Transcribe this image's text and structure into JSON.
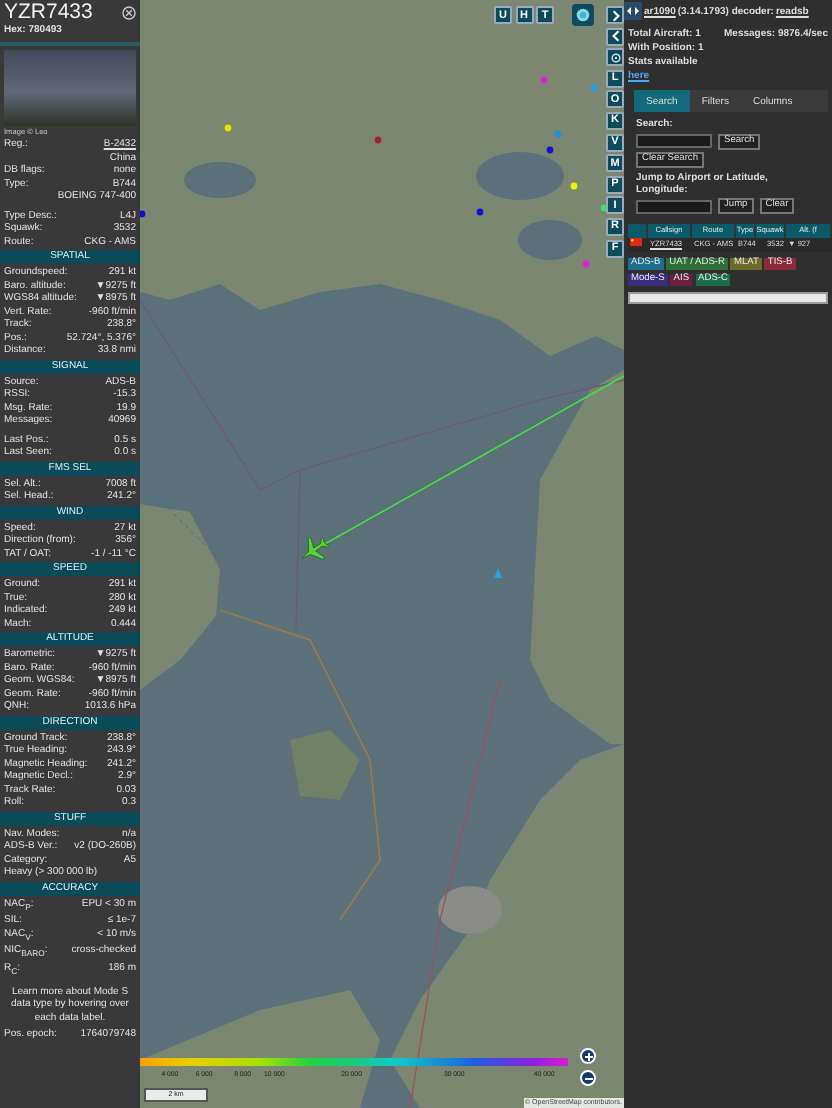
{
  "aircraft": {
    "callsign": "YZR7433",
    "hex": "Hex: 780493",
    "photo_credit": "Image © Leo",
    "sections": [
      {
        "rows": [
          {
            "kind": "link",
            "label": "Reg.:",
            "value": "B-2432"
          },
          {
            "kind": "value",
            "value": "China"
          },
          {
            "kind": "pair",
            "label": "DB flags:",
            "value": "none"
          },
          {
            "kind": "pair",
            "label": "Type:",
            "value": "B744"
          },
          {
            "kind": "value",
            "value": "BOEING 747-400"
          },
          {
            "kind": "pair",
            "label": "Type Desc.:",
            "value": "L4J",
            "gap": true
          },
          {
            "kind": "pair",
            "label": "Squawk:",
            "value": "3532"
          },
          {
            "kind": "pair",
            "label": "Route:",
            "value": "CKG - AMS"
          }
        ]
      },
      {
        "title": "SPATIAL",
        "rows": [
          {
            "kind": "pair",
            "label": "Groundspeed:",
            "value": "291 kt"
          },
          {
            "kind": "pair",
            "label": "Baro. altitude:",
            "value": "▼9275 ft"
          },
          {
            "kind": "pair",
            "label": "WGS84 altitude:",
            "value": "▼8975 ft"
          },
          {
            "kind": "pair",
            "label": "Vert. Rate:",
            "value": "-960 ft/min"
          },
          {
            "kind": "pair",
            "label": "Track:",
            "value": "238.8°"
          },
          {
            "kind": "pair",
            "label": "Pos.:",
            "value": "52.724°, 5.376°"
          },
          {
            "kind": "pair",
            "label": "Distance:",
            "value": "33.8 nmi"
          }
        ]
      },
      {
        "title": "SIGNAL",
        "rows": [
          {
            "kind": "pair",
            "label": "Source:",
            "value": "ADS-B"
          },
          {
            "kind": "pair",
            "label": "RSSI:",
            "value": "-15.3"
          },
          {
            "kind": "pair",
            "label": "Msg. Rate:",
            "value": "19.9"
          },
          {
            "kind": "pair",
            "label": "Messages:",
            "value": "40969"
          },
          {
            "kind": "pair",
            "label": "Last Pos.:",
            "value": "0.5 s",
            "gap": true
          },
          {
            "kind": "pair",
            "label": "Last Seen:",
            "value": "0.0 s"
          }
        ]
      },
      {
        "title": "FMS SEL",
        "rows": [
          {
            "kind": "pair",
            "label": "Sel. Alt.:",
            "value": "7008 ft"
          },
          {
            "kind": "pair",
            "label": "Sel. Head.:",
            "value": "241.2°"
          }
        ]
      },
      {
        "title": "WIND",
        "rows": [
          {
            "kind": "pair",
            "label": "Speed:",
            "value": "27 kt"
          },
          {
            "kind": "pair",
            "label": "Direction (from):",
            "value": "356°"
          },
          {
            "kind": "pair",
            "label": "TAT / OAT:",
            "value": "-1 / -11 °C"
          }
        ]
      },
      {
        "title": "SPEED",
        "rows": [
          {
            "kind": "pair",
            "label": "Ground:",
            "value": "291 kt"
          },
          {
            "kind": "pair",
            "label": "True:",
            "value": "280 kt"
          },
          {
            "kind": "pair",
            "label": "Indicated:",
            "value": "249 kt"
          },
          {
            "kind": "pair",
            "label": "Mach:",
            "value": "0.444"
          }
        ]
      },
      {
        "title": "ALTITUDE",
        "rows": [
          {
            "kind": "pair",
            "label": "Barometric:",
            "value": "▼9275 ft"
          },
          {
            "kind": "pair",
            "label": "Baro. Rate:",
            "value": "-960 ft/min"
          },
          {
            "kind": "pair",
            "label": "Geom. WGS84:",
            "value": "▼8975 ft"
          },
          {
            "kind": "pair",
            "label": "Geom. Rate:",
            "value": "-960 ft/min"
          },
          {
            "kind": "pair",
            "label": "QNH:",
            "value": "1013.6 hPa"
          }
        ]
      },
      {
        "title": "DIRECTION",
        "rows": [
          {
            "kind": "pair",
            "label": "Ground Track:",
            "value": "238.8°"
          },
          {
            "kind": "pair",
            "label": "True Heading:",
            "value": "243.9°"
          },
          {
            "kind": "pair",
            "label": "Magnetic Heading:",
            "value": "241.2°"
          },
          {
            "kind": "pair",
            "label": "Magnetic Decl.:",
            "value": "2.9°"
          },
          {
            "kind": "pair",
            "label": "Track Rate:",
            "value": "0.03"
          },
          {
            "kind": "pair",
            "label": "Roll:",
            "value": "0.3"
          }
        ]
      },
      {
        "title": "STUFF",
        "rows": [
          {
            "kind": "pair",
            "label": "Nav. Modes:",
            "value": "n/a"
          },
          {
            "kind": "pair",
            "label": "ADS-B Ver.:",
            "value": "v2 (DO-260B)"
          },
          {
            "kind": "pair",
            "label": "Category:",
            "value": "A5"
          },
          {
            "kind": "text",
            "value": "Heavy (> 300 000 lb)"
          }
        ]
      },
      {
        "title": "ACCURACY",
        "rows": [
          {
            "kind": "pair",
            "label": "NAC$_{P}$:",
            "value": "EPU < 30 m"
          },
          {
            "kind": "pair",
            "label": "SIL:",
            "value": "≤ 1e-7"
          },
          {
            "kind": "pair",
            "label": "NAC$_{V}$:",
            "value": "< 10 m/s"
          },
          {
            "kind": "pair",
            "label": "NIC$_{BARO}$:",
            "value": "cross-checked"
          },
          {
            "kind": "pair",
            "label": "R$_{C}$:",
            "value": "186 m"
          }
        ]
      }
    ],
    "note": "Learn more about Mode S data type by hovering over each data label.",
    "epoch": {
      "label": "Pos. epoch:",
      "value": "1764079748"
    }
  },
  "map": {
    "top_buttons": [
      "U",
      "H",
      "T"
    ],
    "side_buttons": [
      "L",
      "O",
      "K",
      "V",
      "M",
      "P",
      "I",
      "R",
      "F"
    ],
    "legend": [
      "4 000",
      "6 000",
      "8 000",
      "10 000",
      "20 000",
      "30 000",
      "40 000"
    ],
    "scale": "2 km",
    "attribution": "© OpenStreetMap contributors."
  },
  "sidebar": {
    "app_link": "ar1090",
    "version": "(3.14.1793) decoder:",
    "decoder_link": "readsb",
    "total": "Total Aircraft: 1",
    "messages": "Messages: 9876.4/sec",
    "with_position": "With Position: 1",
    "stats_text": "Stats available",
    "stats_link": "here",
    "tabs": [
      {
        "label": "Search",
        "selected": true
      },
      {
        "label": "Filters",
        "selected": false
      },
      {
        "label": "Columns",
        "selected": false
      }
    ],
    "search": {
      "label": "Search:",
      "button": "Search",
      "clear": "Clear Search",
      "jump_label": "Jump to Airport or Latitude, Longitude:",
      "jump": "Jump",
      "jump_clear": "Clear"
    },
    "table": {
      "columns": [
        "Callsign",
        "Route",
        "Type",
        "Squawk",
        "Alt. (f"
      ],
      "rows": [
        {
          "callsign": "YZR7433",
          "route": "CKG - AMS",
          "type": "B744",
          "squawk": "3532",
          "altitude": "▼ 927"
        }
      ]
    },
    "tags": [
      {
        "label": "ADS-B",
        "color": "#1f6d8c"
      },
      {
        "label": "UAT / ADS-R",
        "color": "#2e6e3a"
      },
      {
        "label": "MLAT",
        "color": "#6b6a2a"
      },
      {
        "label": "TIS-B",
        "color": "#8a2a3a"
      },
      {
        "label": "Mode-S",
        "color": "#3b2d7a"
      },
      {
        "label": "AIS",
        "color": "#6a2040"
      },
      {
        "label": "ADS-C",
        "color": "#1e6e4e"
      }
    ]
  }
}
